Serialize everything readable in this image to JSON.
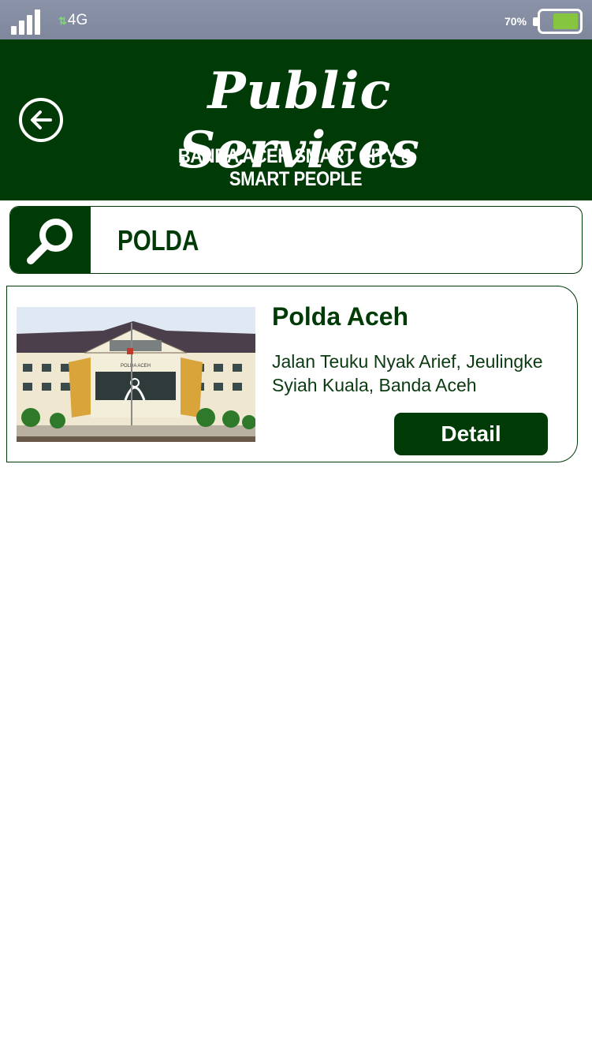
{
  "status_bar": {
    "network": "4G",
    "battery_percent": "70%",
    "battery_level": 0.7,
    "signal_icon": "signal-bars-icon",
    "battery_icon": "battery-icon"
  },
  "header": {
    "title": "Public Services",
    "subtitle": "BANDA ACEH SMART CITY & SMART PEOPLE",
    "back_icon": "back-arrow-icon",
    "background_color": "#003a07"
  },
  "search": {
    "value": "POLDA",
    "icon": "search-icon"
  },
  "results": [
    {
      "name": "Polda Aceh",
      "address": "Jalan Teuku Nyak Arief, Jeulingke Syiah Kuala, Banda Aceh",
      "image_sign_text": "POLDA ACEH",
      "button_label": "Detail"
    }
  ],
  "colors": {
    "primary": "#003a07",
    "battery_fill": "#86c540",
    "status_bar": "#8b93a8"
  }
}
